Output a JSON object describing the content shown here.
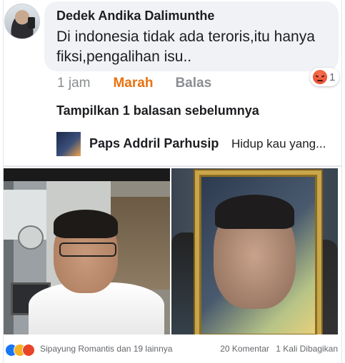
{
  "comment": {
    "author": "Dedek Andika Dalimunthe",
    "text": "Di indonesia tidak ada teroris,itu hanya fiksi,pengalihan isu..",
    "time": "1 jam",
    "reaction_label": "Marah",
    "reply_label": "Balas",
    "reaction_count": "1"
  },
  "replies": {
    "show_previous": "Tampilkan 1 balasan sebelumnya",
    "latest": {
      "author": "Paps Addril Parhusip",
      "text": "Hidup kau yang..."
    }
  },
  "post_footer": {
    "people": "Sipayung Romantis dan 19 lainnya",
    "comments": "20 Komentar",
    "shares": "1 Kali Dibagikan"
  },
  "icons": [
    "like-icon",
    "wow-icon",
    "angry-icon"
  ],
  "colors": {
    "reaction_angry": "#e9710f",
    "bubble": "#f0f2f5"
  }
}
